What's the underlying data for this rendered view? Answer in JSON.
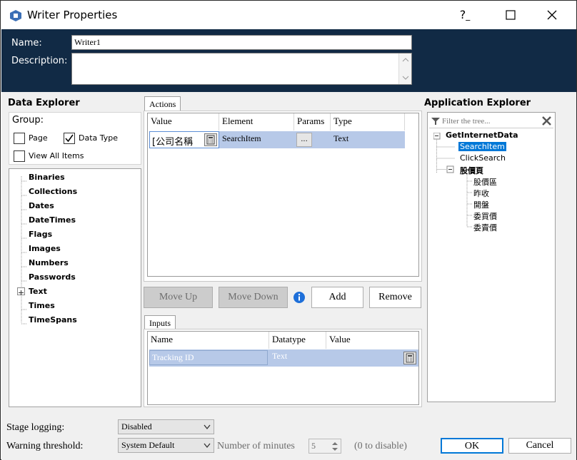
{
  "window": {
    "title": "Writer Properties",
    "help_glyph": "?",
    "min_glyph": "—",
    "max_glyph": "☐",
    "close_glyph": "✕"
  },
  "header": {
    "name_label": "Name:",
    "name_value": "Writer1",
    "description_label": "Description:",
    "description_value": ""
  },
  "data_explorer": {
    "title": "Data Explorer",
    "group_label": "Group:",
    "page_label": "Page",
    "page_checked": false,
    "datatype_label": "Data Type",
    "datatype_checked": true,
    "view_all_label": "View All Items",
    "view_all_checked": false,
    "items": [
      "Binaries",
      "Collections",
      "Dates",
      "DateTimes",
      "Flags",
      "Images",
      "Numbers",
      "Passwords",
      "Text",
      "Times",
      "TimeSpans"
    ]
  },
  "actions": {
    "tab_label": "Actions",
    "columns": [
      "Value",
      "Element",
      "Params",
      "Type"
    ],
    "rows": [
      {
        "value": "[公司名稱",
        "element": "SearchItem",
        "params": "...",
        "type": "Text"
      }
    ],
    "move_up": "Move Up",
    "move_down": "Move Down",
    "add": "Add",
    "remove": "Remove"
  },
  "inputs": {
    "tab_label": "Inputs",
    "columns": [
      "Name",
      "Datatype",
      "Value"
    ],
    "rows": [
      {
        "name": "Tracking ID",
        "datatype": "Text",
        "value": ""
      }
    ]
  },
  "app_explorer": {
    "title": "Application Explorer",
    "filter_placeholder": "Filter the tree...",
    "root": "GetInternetData",
    "children": [
      "SearchItem",
      "ClickSearch"
    ],
    "selected": "SearchItem",
    "group": "股價頁",
    "group_children": [
      "股價區",
      "昨收",
      "開盤",
      "委買價",
      "委賣價"
    ]
  },
  "footer": {
    "stage_logging_label": "Stage logging:",
    "stage_logging_value": "Disabled",
    "warning_label": "Warning threshold:",
    "warning_value": "System Default",
    "minutes_label": "Number of minutes",
    "minutes_value": "5",
    "minutes_hint": "(0 to disable)",
    "ok": "OK",
    "cancel": "Cancel"
  },
  "colors": {
    "header_bg": "#112a45",
    "selection": "#b7c9e8",
    "app_selected": "#0078d7"
  }
}
